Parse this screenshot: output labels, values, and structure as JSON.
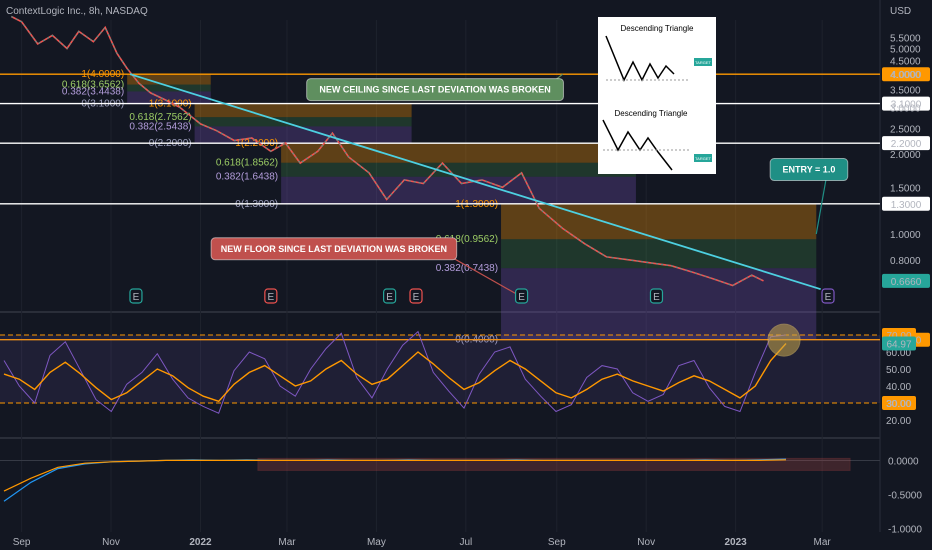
{
  "header": {
    "symbol_title": "ContextLogic Inc., 8h, NASDAQ",
    "currency": "USD"
  },
  "chart_data": [
    {
      "type": "line",
      "panel": "price",
      "yscale": "log",
      "ylim": [
        0.55,
        6.4
      ],
      "x_ticks": [
        "Sep",
        "Nov",
        "2022",
        "Mar",
        "May",
        "Jul",
        "Sep",
        "Nov",
        "2023",
        "Mar"
      ],
      "y_ticks": [
        5.5,
        5.0,
        4.5,
        4.0,
        3.5,
        3.0,
        2.5,
        2.0,
        1.5,
        1.0,
        0.8
      ],
      "y_tick_labels": [
        "5.5000",
        "5.0000",
        "4.5000",
        "4.0000",
        "3.5000",
        "3.0000",
        "2.5000",
        "2.0000",
        "1.5000",
        "1.0000",
        "0.8000"
      ],
      "horizontal_levels": [
        {
          "value": 4.0,
          "label": "4.0000",
          "color": "#ff9800"
        },
        {
          "value": 3.1,
          "label": "3.1000",
          "color": "#ffffff"
        },
        {
          "value": 2.2,
          "label": "2.2000",
          "color": "#ffffff"
        },
        {
          "value": 1.3,
          "label": "1.3000",
          "color": "#ffffff"
        },
        {
          "value": 0.4,
          "label": "0.4000",
          "color": "#ff9800"
        }
      ],
      "last_price": {
        "value": 0.666,
        "label": "0.6660",
        "color": "#26a69a"
      },
      "price_series": [
        {
          "x": "2021-08-25",
          "y": 6.6
        },
        {
          "x": "2021-09-01",
          "y": 6.3
        },
        {
          "x": "2021-09-12",
          "y": 5.2
        },
        {
          "x": "2021-09-22",
          "y": 5.6
        },
        {
          "x": "2021-10-02",
          "y": 5.0
        },
        {
          "x": "2021-10-10",
          "y": 5.8
        },
        {
          "x": "2021-10-20",
          "y": 5.3
        },
        {
          "x": "2021-10-28",
          "y": 6.0
        },
        {
          "x": "2021-11-05",
          "y": 4.8
        },
        {
          "x": "2021-11-12",
          "y": 4.2
        },
        {
          "x": "2021-11-20",
          "y": 3.7
        },
        {
          "x": "2021-11-28",
          "y": 3.4
        },
        {
          "x": "2021-12-08",
          "y": 3.2
        },
        {
          "x": "2021-12-18",
          "y": 3.0
        },
        {
          "x": "2022-01-01",
          "y": 2.6
        },
        {
          "x": "2022-01-12",
          "y": 2.45
        },
        {
          "x": "2022-01-24",
          "y": 2.25
        },
        {
          "x": "2022-02-05",
          "y": 2.3
        },
        {
          "x": "2022-02-18",
          "y": 2.05
        },
        {
          "x": "2022-02-28",
          "y": 2.2
        },
        {
          "x": "2022-03-10",
          "y": 1.85
        },
        {
          "x": "2022-03-22",
          "y": 2.05
        },
        {
          "x": "2022-04-01",
          "y": 2.4
        },
        {
          "x": "2022-04-12",
          "y": 1.95
        },
        {
          "x": "2022-04-26",
          "y": 1.7
        },
        {
          "x": "2022-05-08",
          "y": 1.35
        },
        {
          "x": "2022-05-20",
          "y": 1.6
        },
        {
          "x": "2022-06-02",
          "y": 1.55
        },
        {
          "x": "2022-06-15",
          "y": 1.85
        },
        {
          "x": "2022-06-28",
          "y": 1.55
        },
        {
          "x": "2022-07-12",
          "y": 1.6
        },
        {
          "x": "2022-07-26",
          "y": 1.5
        },
        {
          "x": "2022-08-08",
          "y": 1.7
        },
        {
          "x": "2022-08-20",
          "y": 1.25
        },
        {
          "x": "2022-09-05",
          "y": 1.05
        },
        {
          "x": "2022-09-20",
          "y": 0.92
        },
        {
          "x": "2022-10-05",
          "y": 0.82
        },
        {
          "x": "2022-10-20",
          "y": 0.8
        },
        {
          "x": "2022-11-03",
          "y": 0.78
        },
        {
          "x": "2022-11-18",
          "y": 0.76
        },
        {
          "x": "2022-12-02",
          "y": 0.72
        },
        {
          "x": "2022-12-16",
          "y": 0.68
        },
        {
          "x": "2022-12-30",
          "y": 0.64
        },
        {
          "x": "2023-01-12",
          "y": 0.7
        },
        {
          "x": "2023-01-20",
          "y": 0.666
        }
      ],
      "trendline": {
        "color": "#4dd0e1",
        "points": [
          {
            "x": "2021-11-14",
            "y": 4.0
          },
          {
            "x": "2023-02-28",
            "y": 0.62
          }
        ]
      },
      "fib_retracements": [
        {
          "color": "#ff9800",
          "x_start": "2021-11-12",
          "x_end": "2022-01-08",
          "levels": [
            {
              "ratio": "1",
              "value": 4.0,
              "label": "1(4.0000)"
            },
            {
              "ratio": "0.618",
              "value": 3.6562,
              "label": "0.618(3.6562)"
            },
            {
              "ratio": "0.382",
              "value": 3.4438,
              "label": "0.382(3.4438)"
            },
            {
              "ratio": "0",
              "value": 3.1,
              "label": "0(3.1000)"
            }
          ]
        },
        {
          "color": "#ff9800",
          "x_start": "2021-12-28",
          "x_end": "2022-05-25",
          "levels": [
            {
              "ratio": "1",
              "value": 3.1,
              "label": "1(3.1000)"
            },
            {
              "ratio": "0.618",
              "value": 2.7562,
              "label": "0.618(2.7562)"
            },
            {
              "ratio": "0.382",
              "value": 2.5438,
              "label": "0.382(2.5438)"
            },
            {
              "ratio": "0",
              "value": 2.2,
              "label": "0(2.2000)"
            }
          ]
        },
        {
          "color": "#ff9800",
          "x_start": "2022-02-25",
          "x_end": "2022-10-25",
          "levels": [
            {
              "ratio": "1",
              "value": 2.2,
              "label": "1(2.2000)"
            },
            {
              "ratio": "0.618",
              "value": 1.8562,
              "label": "0.618(1.8562)"
            },
            {
              "ratio": "0.382",
              "value": 1.6438,
              "label": "0.382(1.6438)"
            },
            {
              "ratio": "0",
              "value": 1.3,
              "label": "0(1.3000)"
            }
          ]
        },
        {
          "color": "#ff9800",
          "x_start": "2022-07-25",
          "x_end": "2023-02-25",
          "levels": [
            {
              "ratio": "1",
              "value": 1.3,
              "label": "1(1.3000)"
            },
            {
              "ratio": "0.618",
              "value": 0.9562,
              "label": "0.618(0.9562)"
            },
            {
              "ratio": "0.382",
              "value": 0.7438,
              "label": "0.382(0.7438)"
            },
            {
              "ratio": "0",
              "value": 0.4,
              "label": "0(0.4000)"
            }
          ]
        }
      ],
      "annotations": [
        {
          "text": "NEW CEILING SINCE LAST DEVIATION WAS BROKEN",
          "color": "#5f8f5f",
          "x": "2022-06-10",
          "y": 3.5,
          "pointer_to": {
            "x": "2022-09-05",
            "y": 4.0
          }
        },
        {
          "text": "NEW FLOOR SINCE LAST DEVIATION WAS BROKEN",
          "color": "#c0504d",
          "x": "2022-04-02",
          "y": 0.88,
          "pointer_to": {
            "x": "2022-08-08",
            "y": 0.58
          }
        },
        {
          "text": "ENTRY = 1.0",
          "color": "#1f8f85",
          "x": "2023-02-20",
          "y": 1.75,
          "pointer_to": {
            "x": "2023-02-25",
            "y": 1.0
          }
        }
      ],
      "event_markers": [
        {
          "x": "2021-11-18",
          "label": "E",
          "color": "#26a69a"
        },
        {
          "x": "2022-02-18",
          "label": "E",
          "color": "#ef5350"
        },
        {
          "x": "2022-05-10",
          "label": "E",
          "color": "#26a69a"
        },
        {
          "x": "2022-05-28",
          "label": "E",
          "color": "#ef5350"
        },
        {
          "x": "2022-08-08",
          "label": "E",
          "color": "#26a69a"
        },
        {
          "x": "2022-11-08",
          "label": "E",
          "color": "#26a69a"
        },
        {
          "x": "2023-03-05",
          "label": "E",
          "color": "#7e57c2"
        }
      ],
      "inset": {
        "title_top": "Descending Triangle",
        "title_bottom": "Descending Triangle",
        "target_label": "TARGET"
      }
    },
    {
      "type": "line",
      "panel": "rsi",
      "ylim": [
        10,
        80
      ],
      "y_ticks": [
        60,
        50,
        40,
        30,
        20
      ],
      "y_tick_labels": [
        "60.00",
        "50.00",
        "40.00",
        "30.00",
        "20.00"
      ],
      "bands": [
        {
          "value": 70,
          "label": "70.00"
        },
        {
          "value": 30,
          "label": "30.00"
        }
      ],
      "current": {
        "value": 64.97,
        "label": "64.97"
      },
      "series": [
        {
          "values": [
            47,
            44,
            38,
            48,
            54,
            47,
            39,
            32,
            36,
            43,
            50,
            46,
            39,
            34,
            31,
            41,
            48,
            52,
            46,
            40,
            43,
            50,
            55,
            47,
            41,
            44,
            52,
            60,
            53,
            45,
            38,
            42,
            49,
            55,
            50,
            43,
            36,
            33,
            38,
            44,
            47,
            43,
            40,
            37,
            42,
            46,
            43,
            38,
            33,
            40,
            55,
            65
          ]
        },
        {
          "values": [
            55,
            40,
            30,
            58,
            66,
            49,
            32,
            25,
            41,
            48,
            59,
            44,
            33,
            28,
            24,
            49,
            60,
            56,
            40,
            34,
            50,
            62,
            71,
            45,
            33,
            50,
            64,
            72,
            48,
            37,
            27,
            47,
            60,
            63,
            44,
            34,
            25,
            29,
            45,
            52,
            50,
            36,
            31,
            35,
            52,
            55,
            39,
            28,
            25,
            48,
            69,
            70
          ]
        }
      ]
    },
    {
      "type": "line",
      "panel": "macd",
      "ylim": [
        -1.05,
        0.3
      ],
      "y_ticks": [
        0.0,
        -0.5,
        -1.0
      ],
      "y_tick_labels": [
        "0.0000",
        "-0.5000",
        "-1.0000"
      ],
      "series": [
        {
          "values": [
            -0.6,
            -0.32,
            -0.12,
            -0.05,
            -0.02,
            -0.01,
            0.0,
            0.01,
            0.0,
            0.01,
            0.0,
            0.0,
            0.01,
            0.0,
            0.0,
            0.01,
            0.0,
            0.0,
            0.0,
            0.01,
            0.0,
            0.0,
            0.0,
            0.0,
            0.0,
            0.0,
            0.01,
            0.0,
            0.01,
            0.02
          ]
        },
        {
          "values": [
            -0.45,
            -0.26,
            -0.1,
            -0.04,
            -0.02,
            -0.01,
            0.0,
            0.0,
            0.0,
            0.0,
            0.0,
            0.0,
            0.0,
            0.0,
            0.0,
            0.0,
            0.0,
            0.0,
            0.0,
            0.0,
            0.0,
            0.0,
            0.0,
            0.0,
            0.0,
            0.0,
            0.0,
            0.0,
            0.0,
            0.01
          ]
        }
      ]
    }
  ]
}
